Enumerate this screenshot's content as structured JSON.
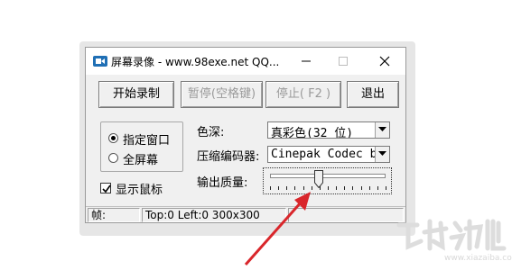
{
  "window": {
    "title": "屏幕录像 - www.98exe.net QQ...",
    "icons": {
      "app": "video-camera-icon",
      "minimize": "minimize-icon",
      "maximize": "maximize-icon",
      "close": "close-icon"
    }
  },
  "toolbar": {
    "start_label": "开始录制",
    "pause_label": "暂停(空格键)",
    "stop_label": "停止( F2 )",
    "exit_label": "退出"
  },
  "capture_mode": {
    "options": [
      {
        "label": "指定窗口",
        "selected": true
      },
      {
        "label": "全屏幕",
        "selected": false
      }
    ]
  },
  "show_cursor": {
    "label": "显示鼠标",
    "checked": true
  },
  "settings": {
    "color_depth_label": "色深:",
    "color_depth_value": "真彩色(32 位)",
    "codec_label": "压缩编码器:",
    "codec_value": "Cinepak Codec by",
    "quality_label": "输出质量:",
    "quality_level": 0.42
  },
  "status": {
    "fps": "帧:",
    "geometry": "Top:0 Left:0 300x300",
    "extra": ""
  },
  "colors": {
    "arrow": "#d9262b",
    "accent": "#1f6fb5",
    "watermark": "#dddddd"
  }
}
